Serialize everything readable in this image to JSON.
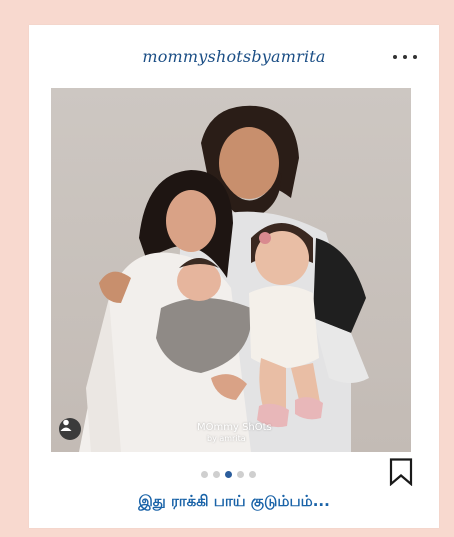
{
  "post": {
    "username": "mommyshotsbyamrita",
    "watermark_line1": "MOmmy ShOts",
    "watermark_line2": "by amrita",
    "carousel": {
      "total": 5,
      "active_index": 3
    },
    "caption": "இது ராக்கி பாய் குடும்பம்..."
  },
  "icons": {
    "more": "more-options-icon",
    "user_tag": "user-tag-icon",
    "bookmark": "bookmark-icon"
  },
  "colors": {
    "background": "#f8d9cf",
    "username": "#1c4f86",
    "caption": "#1a63a8",
    "dot_active": "#2b5d9c"
  }
}
